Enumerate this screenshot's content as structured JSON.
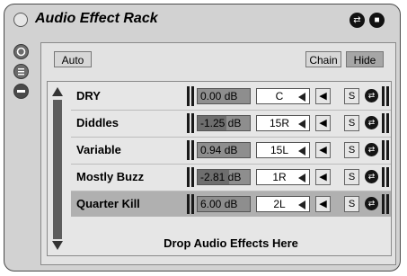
{
  "rack": {
    "title": "Audio Effect Rack",
    "auto_label": "Auto",
    "chain_label": "Chain",
    "hide_label": "Hide",
    "drop_text": "Drop Audio Effects Here"
  },
  "chains": [
    {
      "name": "DRY",
      "volume": "0.00 dB",
      "pan": "C",
      "solo": "S",
      "selected": false
    },
    {
      "name": "Diddles",
      "volume": "-1.25 dB",
      "pan": "15R",
      "solo": "S",
      "selected": false
    },
    {
      "name": "Variable",
      "volume": "0.94 dB",
      "pan": "15L",
      "solo": "S",
      "selected": false
    },
    {
      "name": "Mostly Buzz",
      "volume": "-2.81 dB",
      "pan": "1R",
      "solo": "S",
      "selected": false
    },
    {
      "name": "Quarter Kill",
      "volume": "6.00 dB",
      "pan": "2L",
      "solo": "S",
      "selected": true
    }
  ],
  "icons": {
    "activator": "activator-icon",
    "hot_swap": "hot-swap-icon",
    "save": "save-preset-icon",
    "chain_list_toggle": "chain-list-icon",
    "macros_toggle": "macro-icon",
    "devices_toggle": "devices-icon",
    "speaker": "speaker-icon"
  }
}
